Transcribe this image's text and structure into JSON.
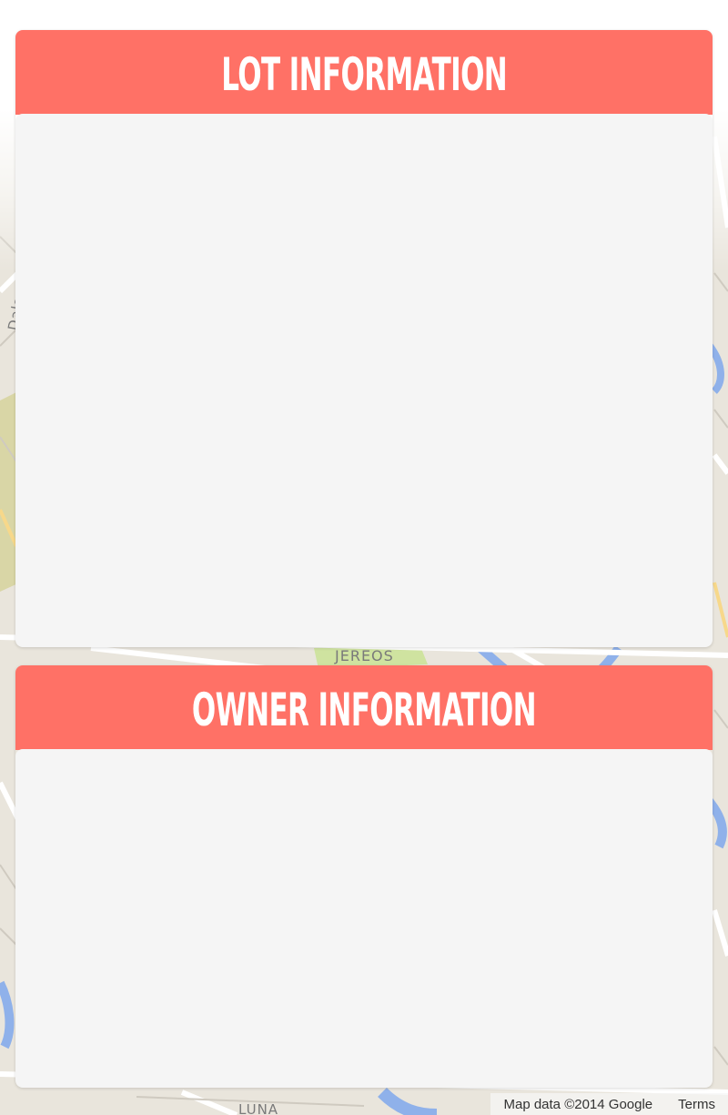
{
  "panels": {
    "lot": {
      "title": "LOT INFORMATION"
    },
    "owner": {
      "title": "OWNER INFORMATION"
    }
  },
  "map": {
    "labels": [
      "JEREOS",
      "Dalan",
      "LUNA"
    ],
    "attribution": "Map data ©2014 Google",
    "terms": "Terms"
  },
  "colors": {
    "header": "#ff7166",
    "panel_body": "#f5f5f5",
    "water": "#a4c2f4",
    "road": "#ffffff",
    "park": "#cde3a6"
  }
}
